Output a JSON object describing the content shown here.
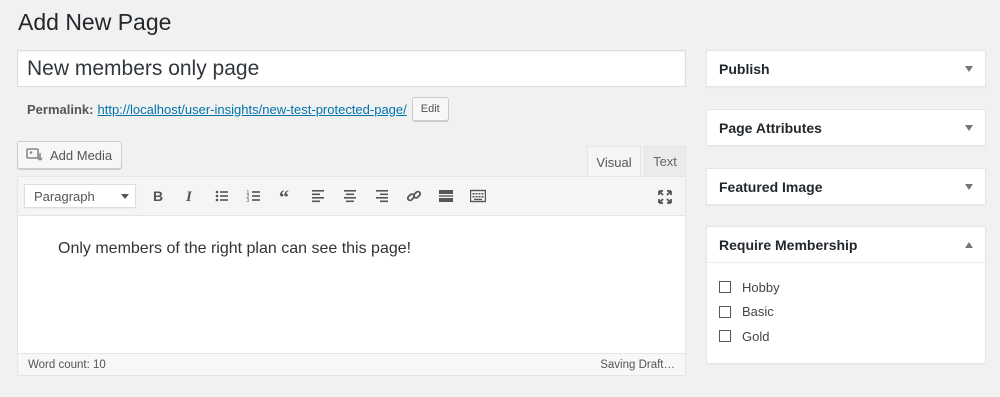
{
  "page": {
    "title": "Add New Page"
  },
  "editor_title": {
    "value": "New members only page"
  },
  "permalink": {
    "label": "Permalink:",
    "url": "http://localhost/user-insights/new-test-protected-page/",
    "edit_label": "Edit"
  },
  "media": {
    "add_media_label": "Add Media"
  },
  "tabs": {
    "visual": "Visual",
    "text": "Text"
  },
  "toolbar": {
    "format_value": "Paragraph"
  },
  "content": {
    "text": "Only members of the right plan can see this page!"
  },
  "status": {
    "word_count": "Word count: 10",
    "saving": "Saving Draft…"
  },
  "sidebar": {
    "publish": "Publish",
    "page_attributes": "Page Attributes",
    "featured_image": "Featured Image",
    "require_membership": {
      "title": "Require Membership",
      "options": [
        "Hobby",
        "Basic",
        "Gold"
      ]
    }
  }
}
